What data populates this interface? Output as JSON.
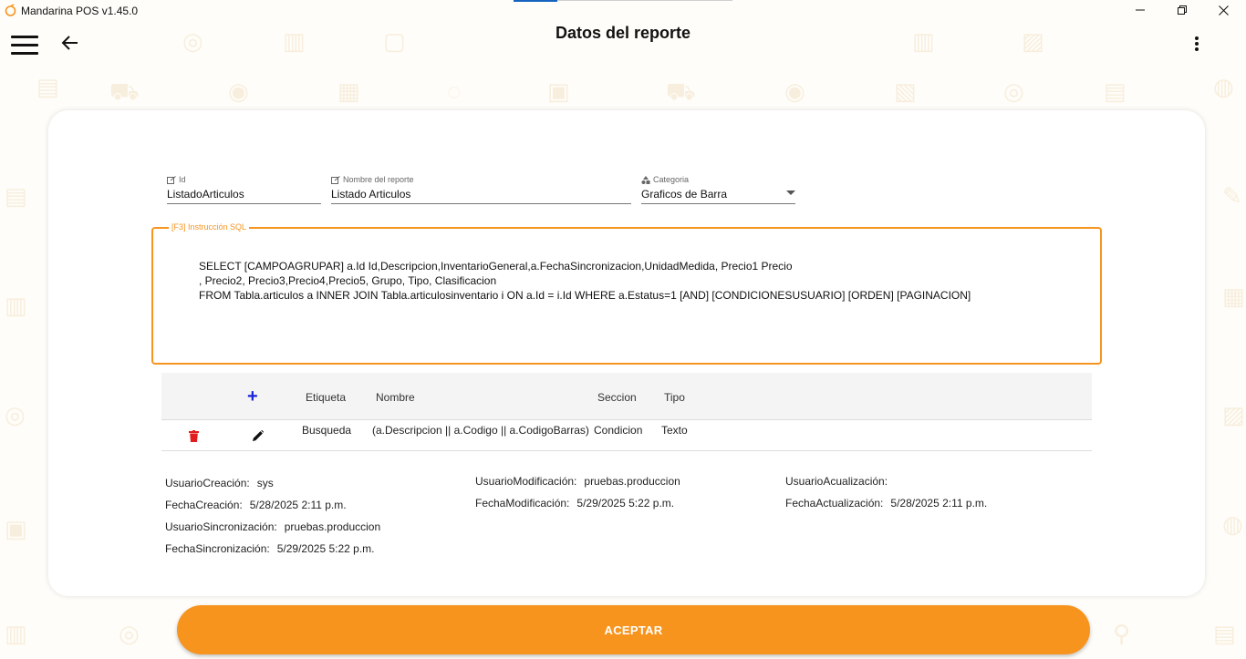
{
  "app": {
    "title": "Mandarina POS v1.45.0"
  },
  "header": {
    "title": "Datos del reporte"
  },
  "form": {
    "id": {
      "label": "Id",
      "value": "ListadoArticulos"
    },
    "nombre": {
      "label": "Nombre del reporte",
      "value": "Listado Articulos"
    },
    "categoria": {
      "label": "Categoria",
      "value": "Graficos de Barra"
    },
    "sql": {
      "label": "[F3] Instrucción SQL",
      "line1": "SELECT [CAMPOAGRUPAR] a.Id Id,Descripcion,InventarioGeneral,a.FechaSincronizacion,UnidadMedida, Precio1 Precio",
      "line2": ", Precio2, Precio3,Precio4,Precio5, Grupo, Tipo, Clasificacion",
      "line3": "FROM Tabla.articulos a INNER JOIN Tabla.articulosinventario i ON a.Id = i.Id WHERE a.Estatus=1 [AND] [CONDICIONESUSUARIO] [ORDEN] [PAGINACION]"
    }
  },
  "table": {
    "add_label": "+",
    "headers": {
      "etiqueta": "Etiqueta",
      "nombre": "Nombre",
      "seccion": "Seccion",
      "tipo": "Tipo"
    },
    "rows": [
      {
        "etiqueta": "Busqueda",
        "nombre": "(a.Descripcion || a.Codigo || a.CodigoBarras)",
        "seccion": "Condicion",
        "tipo": "Texto"
      }
    ]
  },
  "meta": {
    "usuario_creacion": {
      "label": "UsuarioCreación:",
      "value": "sys"
    },
    "fecha_creacion": {
      "label": "FechaCreación:",
      "value": "5/28/2025 2:11 p.m."
    },
    "usuario_sincronizacion": {
      "label": "UsuarioSincronización:",
      "value": "pruebas.produccion"
    },
    "fecha_sincronizacion": {
      "label": "FechaSincronización:",
      "value": "5/29/2025 5:22 p.m."
    },
    "usuario_modificacion": {
      "label": "UsuarioModificación:",
      "value": "pruebas.produccion"
    },
    "fecha_modificacion": {
      "label": "FechaModificación:",
      "value": "5/29/2025 5:22 p.m."
    },
    "usuario_actualizacion": {
      "label": "UsuarioAcualización:",
      "value": ""
    },
    "fecha_actualizacion": {
      "label": "FechaActualización:",
      "value": "5/28/2025 2:11 p.m."
    }
  },
  "footer": {
    "accept_label": "ACEPTAR"
  },
  "colors": {
    "accent": "#f7941d",
    "add_icon": "#1a23d8",
    "delete_icon": "#e11d1d"
  },
  "icons": [
    "menu-icon",
    "back-arrow-icon",
    "more-vert-icon",
    "edit-field-icon",
    "category-icon",
    "add-icon",
    "delete-icon",
    "pencil-icon"
  ]
}
